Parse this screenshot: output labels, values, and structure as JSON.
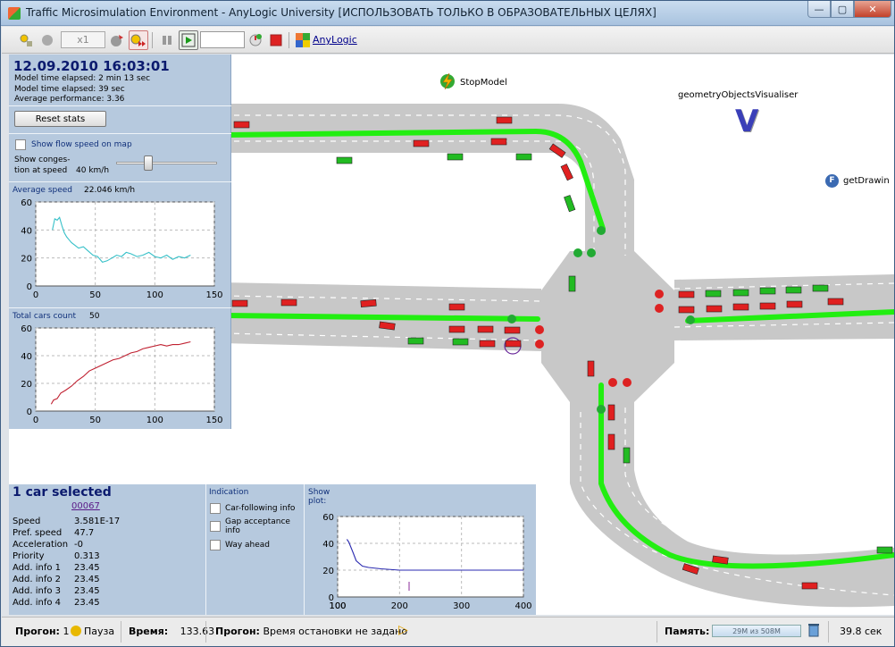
{
  "window": {
    "title": "Traffic Microsimulation Environment - AnyLogic University  [ИСПОЛЬЗОВАТЬ ТОЛЬКО В ОБРАЗОВАТЕЛЬНЫХ ЦЕЛЯХ]",
    "minimize": "—",
    "maximize": "▢",
    "close": "✕"
  },
  "toolbar": {
    "speed": "x1",
    "anylogic_link": "AnyLogic"
  },
  "left_panel": {
    "datetime": "12.09.2010 16:03:01",
    "elapsed_label": "Model time elapsed: 2 min 13 sec",
    "elapsed_real": "Model time elapsed: 39 sec",
    "performance": "Average performance: 3.36",
    "reset_button": "Reset stats",
    "flow_speed_label": "Show flow speed on map",
    "congestion_label_1": "Show conges-",
    "congestion_label_2": "tion at speed",
    "congestion_value": "40 km/h",
    "avg_speed_label": "Average speed",
    "avg_speed_value": "22.046 km/h",
    "total_cars_label": "Total cars count",
    "total_cars_value": "50"
  },
  "chart_data": [
    {
      "type": "line",
      "title": "Average speed",
      "x_ticks": [
        "0",
        "50",
        "100",
        "150"
      ],
      "y_ticks": [
        "0",
        "20",
        "40",
        "60"
      ],
      "xlim": [
        0,
        150
      ],
      "ylim": [
        0,
        60
      ],
      "series": [
        {
          "x": [
            14,
            16,
            18,
            20,
            22,
            24,
            26,
            28,
            30,
            33,
            36,
            40,
            44,
            48,
            52,
            56,
            60,
            64,
            68,
            72,
            76,
            80,
            85,
            90,
            95,
            100,
            105,
            110,
            115,
            120,
            125,
            130
          ],
          "values": [
            40,
            48,
            47,
            49,
            43,
            38,
            35,
            33,
            31,
            29,
            27,
            28,
            25,
            22,
            21,
            17,
            18,
            20,
            22,
            21,
            24,
            23,
            21,
            22,
            24,
            21,
            20,
            22,
            19,
            21,
            20,
            22
          ]
        }
      ]
    },
    {
      "type": "line",
      "title": "Total cars count",
      "x_ticks": [
        "0",
        "50",
        "100",
        "150"
      ],
      "y_ticks": [
        "0",
        "20",
        "40",
        "60"
      ],
      "xlim": [
        0,
        150
      ],
      "ylim": [
        0,
        60
      ],
      "series": [
        {
          "x": [
            13,
            15,
            18,
            21,
            25,
            30,
            35,
            40,
            45,
            50,
            55,
            60,
            65,
            70,
            75,
            80,
            85,
            90,
            95,
            100,
            105,
            110,
            115,
            120,
            125,
            130
          ],
          "values": [
            5,
            8,
            9,
            13,
            15,
            18,
            22,
            25,
            29,
            31,
            33,
            35,
            37,
            38,
            40,
            42,
            43,
            45,
            46,
            47,
            48,
            47,
            48,
            48,
            49,
            50
          ]
        }
      ]
    },
    {
      "type": "line",
      "title": "Show plot:",
      "x_ticks": [
        "100",
        "100",
        "200",
        "300",
        "400"
      ],
      "y_ticks": [
        "0",
        "20",
        "40",
        "60"
      ],
      "xlim": [
        100,
        400
      ],
      "ylim": [
        0,
        60
      ],
      "series": [
        {
          "x": [
            115,
            118,
            125,
            130,
            140,
            150,
            170,
            200,
            250,
            300,
            350,
            400
          ],
          "values": [
            43,
            41,
            33,
            27,
            23,
            22,
            21,
            20,
            20,
            20,
            20,
            20
          ]
        }
      ]
    }
  ],
  "bottom_panel": {
    "title": "1 car selected",
    "car_id": "00067",
    "rows": [
      {
        "label": "Speed",
        "value": "3.581E-17"
      },
      {
        "label": "Pref. speed",
        "value": "47.7"
      },
      {
        "label": "Acceleration",
        "value": "-0"
      },
      {
        "label": "Priority",
        "value": "0.313"
      },
      {
        "label": "Add. info 1",
        "value": "23.45"
      },
      {
        "label": "Add. info 2",
        "value": "23.45"
      },
      {
        "label": "Add. info 3",
        "value": "23.45"
      },
      {
        "label": "Add. info 4",
        "value": "23.45"
      }
    ],
    "indication_title": "Indication",
    "ind_car_following": "Car-following info",
    "ind_gap_1": "Gap acceptance",
    "ind_gap_2": "info",
    "ind_way_ahead": "Way ahead",
    "plot_title_1": "Show",
    "plot_title_2": "plot:"
  },
  "map": {
    "stop_model": "StopModel",
    "visualiser": "geometryObjectsVisualiser",
    "getdrawing": "getDrawin",
    "f_icon": "F"
  },
  "statusbar": {
    "run_label": "Прогон:",
    "run_value": "1",
    "state": "Пауза",
    "time_label": "Время:",
    "time_value": "133.63",
    "run2_label": "Прогон:",
    "run2_value": "Время остановки не задано",
    "memory_label": "Память:",
    "memory_value": "29M из 508M",
    "elapsed": "39.8 сек"
  },
  "colors": {
    "panel": "#b6c9de",
    "road": "#c8c8c8",
    "lane_green": "#22ee11",
    "light_red": "#dd2222",
    "light_green": "#22aa33",
    "car_red": "#e02020",
    "car_green": "#22bb22"
  }
}
